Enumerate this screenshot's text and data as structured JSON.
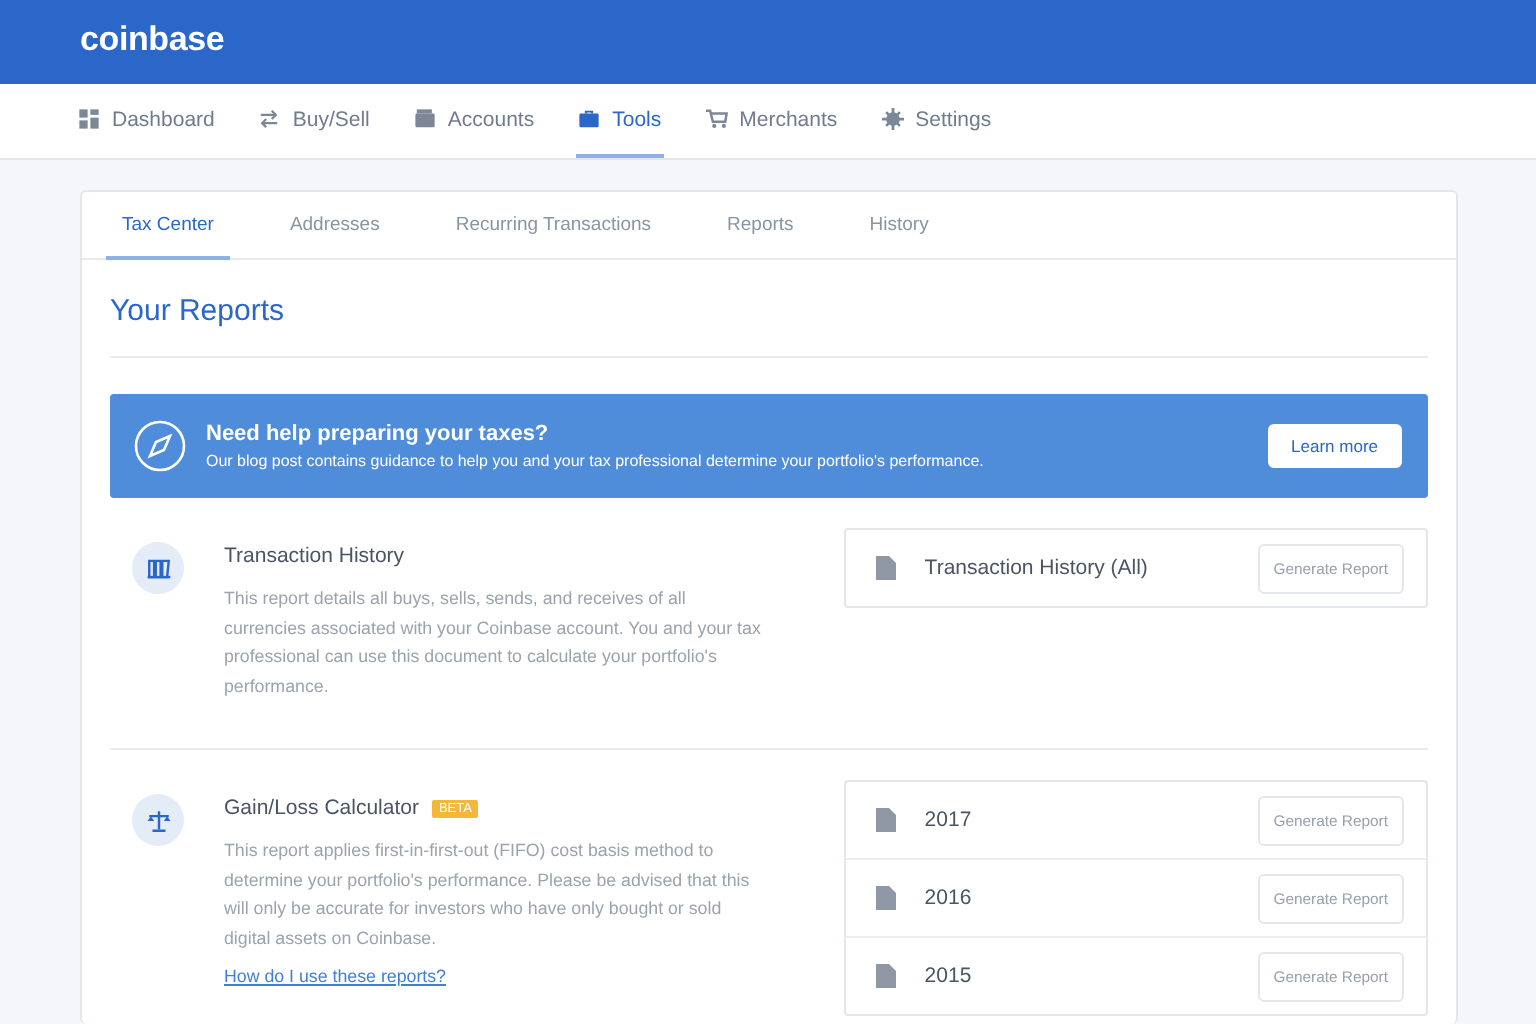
{
  "brand": "coinbase",
  "nav": [
    {
      "label": "Dashboard",
      "selected": false
    },
    {
      "label": "Buy/Sell",
      "selected": false
    },
    {
      "label": "Accounts",
      "selected": false
    },
    {
      "label": "Tools",
      "selected": true
    },
    {
      "label": "Merchants",
      "selected": false
    },
    {
      "label": "Settings",
      "selected": false
    }
  ],
  "subtabs": [
    {
      "label": "Tax Center",
      "selected": true
    },
    {
      "label": "Addresses",
      "selected": false
    },
    {
      "label": "Recurring Transactions",
      "selected": false
    },
    {
      "label": "Reports",
      "selected": false
    },
    {
      "label": "History",
      "selected": false
    }
  ],
  "heading": "Your Reports",
  "banner": {
    "title": "Need help preparing your taxes?",
    "text": "Our blog post contains guidance to help you and your tax professional determine your portfolio's performance.",
    "button": "Learn more"
  },
  "reports": [
    {
      "title": "Transaction History",
      "text": "This report details all buys, sells, sends, and receives of all currencies associated with your Coinbase account. You and your tax professional can use this document to calculate your portfolio's performance.",
      "files": [
        {
          "name": "Transaction History (All)",
          "button": "Generate Report"
        }
      ]
    },
    {
      "title": "Gain/Loss Calculator",
      "badge": "BETA",
      "text": "This report applies first-in-first-out (FIFO) cost basis method to determine your portfolio's performance. Please be advised that this will only be accurate for investors who have only bought or sold digital assets on Coinbase.",
      "link": "How do I use these reports?",
      "files": [
        {
          "name": "2017",
          "button": "Generate Report"
        },
        {
          "name": "2016",
          "button": "Generate Report"
        },
        {
          "name": "2015",
          "button": "Generate Report"
        }
      ]
    }
  ]
}
